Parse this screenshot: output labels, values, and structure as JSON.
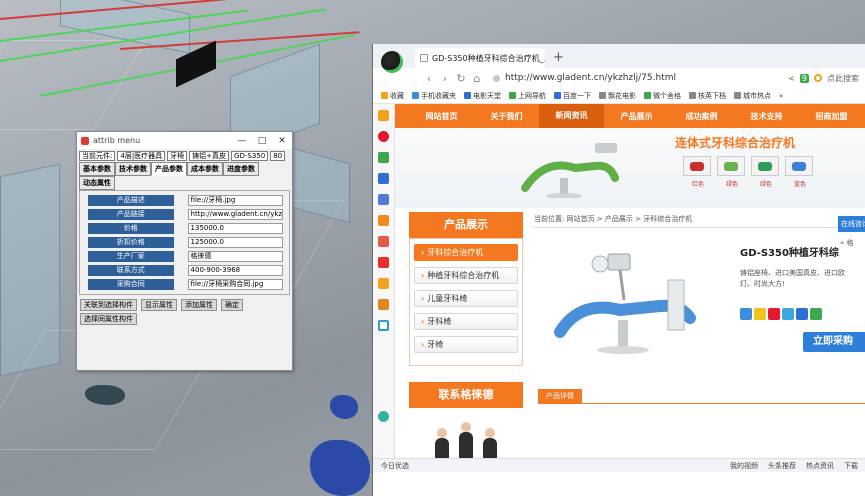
{
  "attrib_window": {
    "title": "attrib menu",
    "controls": {
      "minimize": "—",
      "maximize": "□",
      "close": "✕"
    },
    "path_cells": [
      "当前元件:",
      "4层|医疗器具",
      "牙椅",
      "铸铝+真皮",
      "GD-S350",
      "80"
    ],
    "tabs": [
      "基本参数",
      "技术参数",
      "产品参数",
      "成本参数",
      "进度参数",
      "动态属性"
    ],
    "active_tab": "产品参数",
    "attributes": [
      {
        "label": "产品描述",
        "value": "file://牙椅.jpg"
      },
      {
        "label": "产品链接",
        "value": "http://www.gladent.cn/ykzhz"
      },
      {
        "label": "价格",
        "value": "135000.0"
      },
      {
        "label": "折扣价格",
        "value": "125000.0"
      },
      {
        "label": "生产厂家",
        "value": "格徕德"
      },
      {
        "label": "联系方式",
        "value": "400-900-3968"
      },
      {
        "label": "采购合同",
        "value": "file://牙椅采购合同.jpg"
      }
    ],
    "buttons_row1": [
      "关联到选择构件",
      "显示属性",
      "添加属性",
      "确定"
    ],
    "buttons_row2": [
      "选择同属性构件"
    ]
  },
  "browser": {
    "tab_title": "GD-S350种植牙科综合治疗机_牙",
    "tab_close": "✕",
    "new_tab": "+",
    "url": "http://www.gladent.cn/ykzhzlj/75.html",
    "nav": {
      "back": "‹",
      "forward": "›",
      "reload": "↻",
      "home": "⌂"
    },
    "addr_right": {
      "share": "<",
      "badge": "9",
      "search_hint": "点此搜索"
    },
    "bookmarks": [
      {
        "label": "收藏",
        "color": "#f2a21c"
      },
      {
        "label": "手机收藏夹",
        "color": "#3b8de0"
      },
      {
        "label": "电影天堂",
        "color": "#2f6fd1"
      },
      {
        "label": "上网导航",
        "color": "#3aa84b"
      },
      {
        "label": "百度一下",
        "color": "#2f6fd1"
      },
      {
        "label": "飘花电影",
        "color": "#888888"
      },
      {
        "label": "微个舍格",
        "color": "#3aa84b"
      },
      {
        "label": "核英下档",
        "color": "#888888"
      },
      {
        "label": "城市热点",
        "color": "#888888"
      }
    ],
    "bookmarks_more": "»",
    "site": {
      "nav": [
        "网站首页",
        "关于我们",
        "新闻资讯",
        "产品展示",
        "成功案例",
        "技术支持",
        "招商加盟"
      ],
      "active_nav": "新闻资讯",
      "banner_slogan": "连体式牙科综合治疗机",
      "swatches": [
        {
          "label": "红色",
          "color": "#c9302c"
        },
        {
          "label": "绿色",
          "color": "#6ab04c"
        },
        {
          "label": "绿色",
          "color": "#2e9d5b"
        },
        {
          "label": "蓝色",
          "color": "#3c7fd6"
        }
      ],
      "left_box_title": "产品展示",
      "categories": [
        "牙科综合治疗机",
        "种植牙科综合治疗机",
        "儿童牙科椅",
        "牙科椅",
        "牙椅"
      ],
      "active_category": "牙科综合治疗机",
      "contact_title": "联系格徕德",
      "breadcrumb": "当前位置: 网站首页 > 产品展示 > 牙科综合治疗机",
      "product_title": "GD-S350种植牙科综",
      "product_desc": "铸铝座椅、进口美国真皮、进口欧",
      "product_desc2": "灯、时尚大方!",
      "buy_button": "立即采购",
      "detail_tab": "产品详情",
      "consult": "在线咨询",
      "consult_arrow": "« 格"
    },
    "statusbar": {
      "left": "今日优选",
      "items": [
        "我的视频",
        "头条推荐",
        "热点资讯"
      ],
      "download": "下载"
    }
  },
  "colors": {
    "site_orange": "#f47820",
    "attr_label_blue": "#2f5f98",
    "beam_green": "#4fd35a",
    "beam_red": "#d43c3c"
  }
}
